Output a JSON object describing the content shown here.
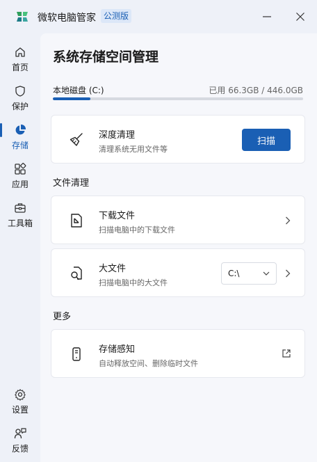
{
  "app": {
    "title": "微软电脑管家",
    "badge": "公测版"
  },
  "sidebar": {
    "items": [
      {
        "label": "首页",
        "icon": "home-icon"
      },
      {
        "label": "保护",
        "icon": "shield-icon"
      },
      {
        "label": "存储",
        "icon": "pie-chart-icon",
        "active": true
      },
      {
        "label": "应用",
        "icon": "apps-icon"
      },
      {
        "label": "工具箱",
        "icon": "toolbox-icon"
      }
    ],
    "bottom": [
      {
        "label": "设置",
        "icon": "gear-icon"
      },
      {
        "label": "反馈",
        "icon": "feedback-icon"
      }
    ]
  },
  "page": {
    "title": "系统存储空间管理",
    "disk": {
      "label": "本地磁盘 (C:)",
      "usage": "已用 66.3GB / 446.0GB",
      "used_fraction": 0.149
    }
  },
  "deep_clean": {
    "title": "深度清理",
    "subtitle": "清理系统无用文件等",
    "button": "扫描"
  },
  "file_clean": {
    "section": "文件清理",
    "downloads": {
      "title": "下载文件",
      "subtitle": "扫描电脑中的下载文件"
    },
    "large": {
      "title": "大文件",
      "subtitle": "扫描电脑中的大文件",
      "drive": "C:\\"
    }
  },
  "more": {
    "section": "更多",
    "storage_sense": {
      "title": "存储感知",
      "subtitle": "自动释放空间、删除临时文件"
    }
  },
  "colors": {
    "accent": "#1a5fb4",
    "background": "#eef1f8",
    "card": "#ffffff"
  }
}
